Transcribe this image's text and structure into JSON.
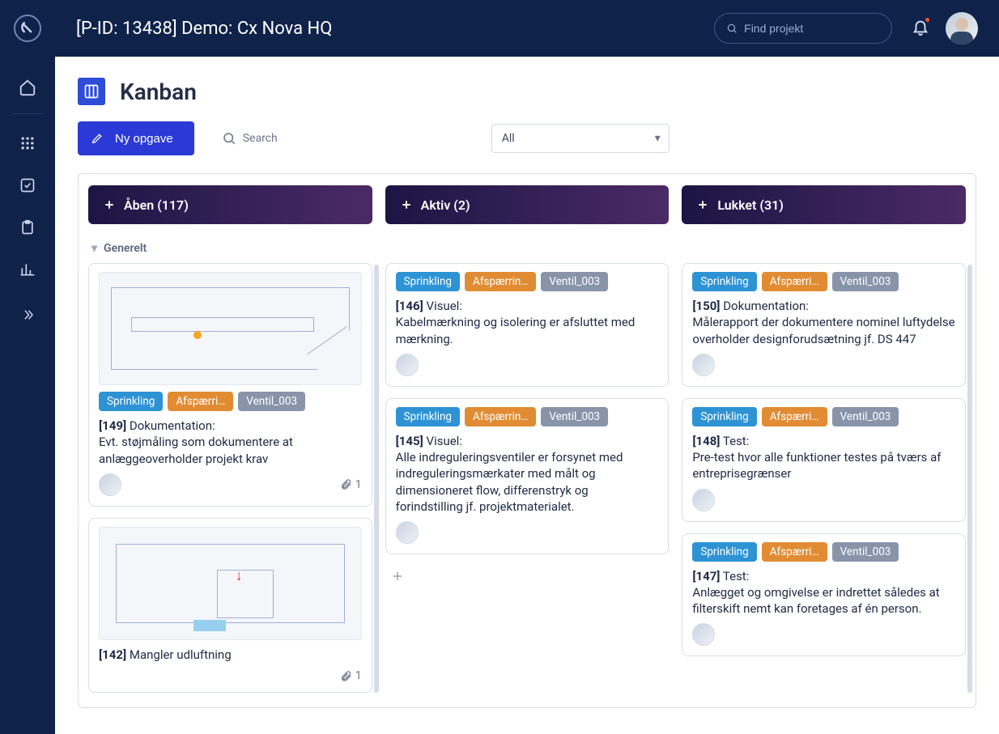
{
  "header": {
    "title": "[P-ID: 13438] Demo: Cx Nova HQ",
    "search_placeholder": "Find projekt"
  },
  "page": {
    "title": "Kanban"
  },
  "toolbar": {
    "new_task": "Ny opgave",
    "search_label": "Search",
    "filter_value": "All"
  },
  "columns": [
    {
      "key": "open",
      "title": "Åben (117)"
    },
    {
      "key": "active",
      "title": "Aktiv (2)"
    },
    {
      "key": "closed",
      "title": "Lukket (31)"
    }
  ],
  "section": "Generelt",
  "tags": {
    "blue": "Sprinkling",
    "orange": "Afspærrin…",
    "orange_alt": "Afspærri…",
    "gray": "Ventil_003"
  },
  "cards": {
    "open": [
      {
        "id": "[149]",
        "kind": "Dokumentation:",
        "desc": "Evt. støjmåling som dokumentere at anlæggeoverholder projekt krav",
        "attachments": "1",
        "thumb": "plan"
      },
      {
        "id": "[142]",
        "kind": "Mangler udluftning",
        "desc": "",
        "attachments": "1",
        "thumb": "site"
      }
    ],
    "active": [
      {
        "id": "[146]",
        "kind": "Visuel:",
        "desc": "Kabelmærkning og isolering er afsluttet med mærkning."
      },
      {
        "id": "[145]",
        "kind": "Visuel:",
        "desc": "Alle indreguleringsventiler er forsynet med indreguleringsmærkater med målt og dimensioneret flow, differenstryk og forindstilling jf. projektmaterialet."
      }
    ],
    "closed": [
      {
        "id": "[150]",
        "kind": "Dokumentation:",
        "desc": "Målerapport der dokumentere nominel luftydelse overholder designforudsætning jf. DS 447"
      },
      {
        "id": "[148]",
        "kind": "Test:",
        "desc": "Pre-test hvor alle funktioner testes på tværs af entreprisegrænser"
      },
      {
        "id": "[147]",
        "kind": "Test:",
        "desc": "Anlægget og omgivelse er indrettet således at filterskift nemt kan foretages af én person."
      }
    ]
  }
}
